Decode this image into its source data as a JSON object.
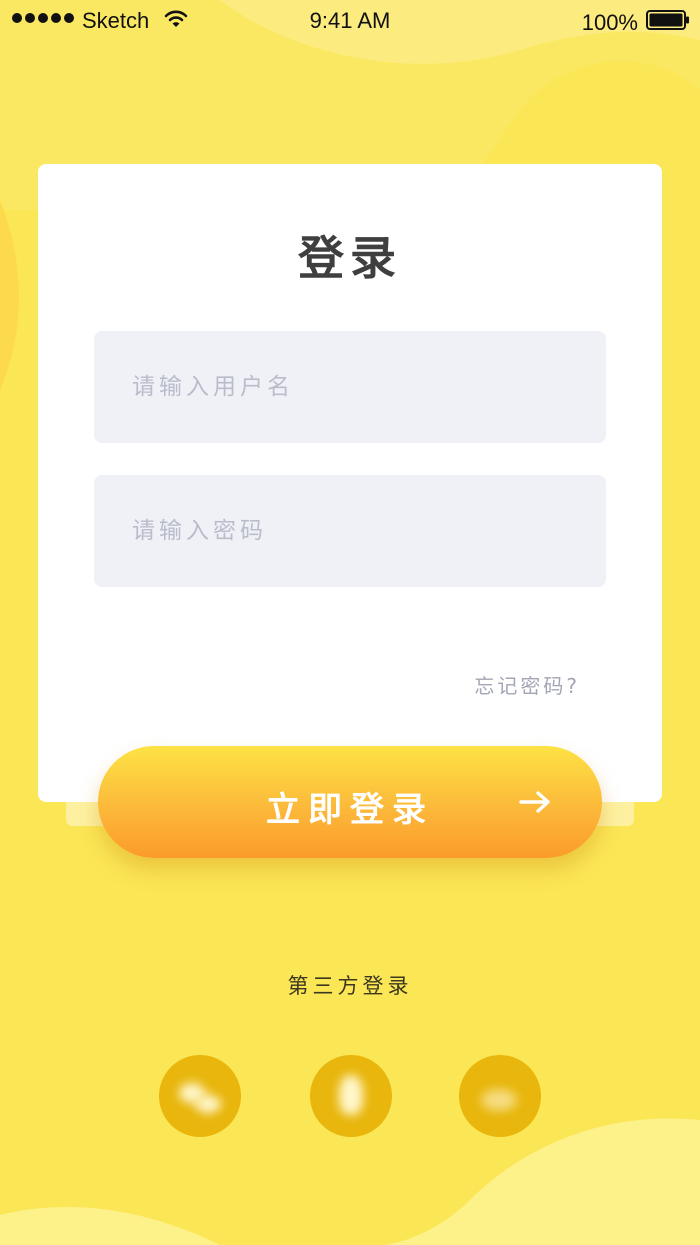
{
  "status_bar": {
    "carrier": "Sketch",
    "time": "9:41 AM",
    "battery_percent": "100%",
    "icons": [
      "signal-dots-icon",
      "wifi-icon",
      "battery-icon"
    ]
  },
  "login": {
    "title": "登录",
    "username_placeholder": "请输入用户名",
    "password_placeholder": "请输入密码",
    "forgot_password": "忘记密码?",
    "submit_label": "立即登录",
    "submit_icon": "arrow-right-icon"
  },
  "third_party": {
    "title": "第三方登录",
    "icons": [
      "wechat-icon",
      "qq-icon",
      "weibo-icon"
    ]
  },
  "colors": {
    "background": "#fbe655",
    "card": "#ffffff",
    "input_bg": "#f0f1f6",
    "button_top": "#fde345",
    "button_bottom": "#fb9b2a",
    "social_circle": "#e8b60c"
  }
}
